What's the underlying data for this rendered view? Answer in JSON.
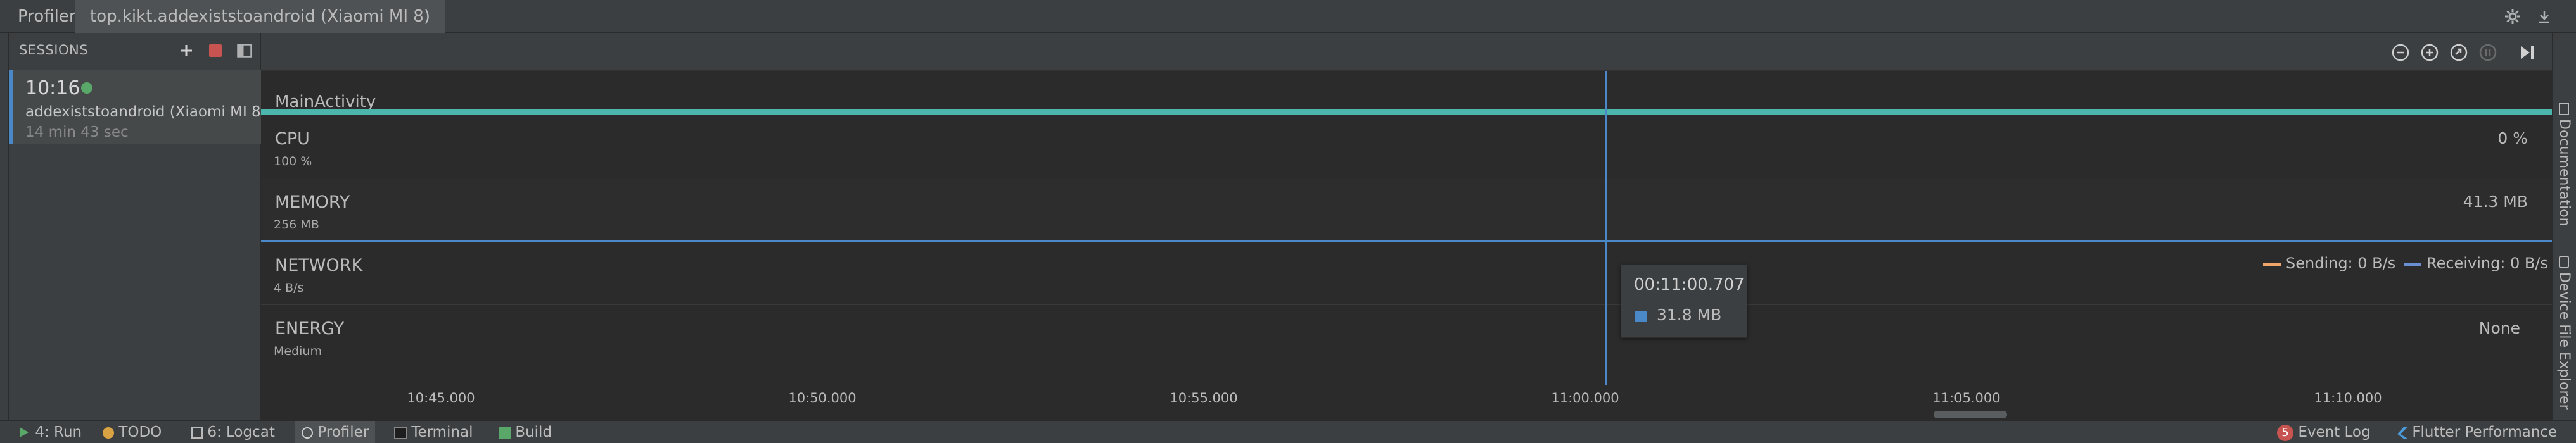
{
  "tabs": {
    "profiler": "Profiler",
    "app": "top.kikt.addexiststoandroid (Xiaomi MI 8)"
  },
  "sessions": {
    "header": "SESSIONS",
    "item": {
      "time": "10:16",
      "name": "addexiststoandroid (Xiaomi MI 8)",
      "duration": "14 min 43 sec"
    }
  },
  "lanes": {
    "activity": {
      "name": "MainActivity"
    },
    "cpu": {
      "name": "CPU",
      "scale": "100 %",
      "value": "0 %"
    },
    "memory": {
      "name": "MEMORY",
      "scale": "256 MB",
      "value": "41.3 MB"
    },
    "network": {
      "name": "NETWORK",
      "scale": "4 B/s",
      "sending": "Sending: 0 B/s",
      "receiving": "Receiving: 0 B/s"
    },
    "energy": {
      "name": "ENERGY",
      "scale": "Medium",
      "value": "None"
    }
  },
  "tooltip": {
    "time": "00:11:00.707",
    "value": "31.8 MB"
  },
  "timeline": {
    "ticks": [
      "10:45.000",
      "10:50.000",
      "10:55.000",
      "11:00.000",
      "11:05.000",
      "11:10.000"
    ]
  },
  "sidebar_right": {
    "documentation": "Documentation",
    "device_file_explorer": "Device File Explorer"
  },
  "bottom": {
    "run": "4: Run",
    "todo": "TODO",
    "logcat": "6: Logcat",
    "profiler": "Profiler",
    "terminal": "Terminal",
    "build": "Build",
    "event_log": "Event Log",
    "event_count": "5",
    "flutter": "Flutter Performance"
  },
  "colors": {
    "activity": "#4db6ac",
    "cursor": "#4a88c7",
    "memory_swatch": "#4a88c7",
    "sending": "#f0a46a",
    "receiving": "#6a8fd1",
    "live": "#59a869",
    "stop": "#c75450"
  }
}
